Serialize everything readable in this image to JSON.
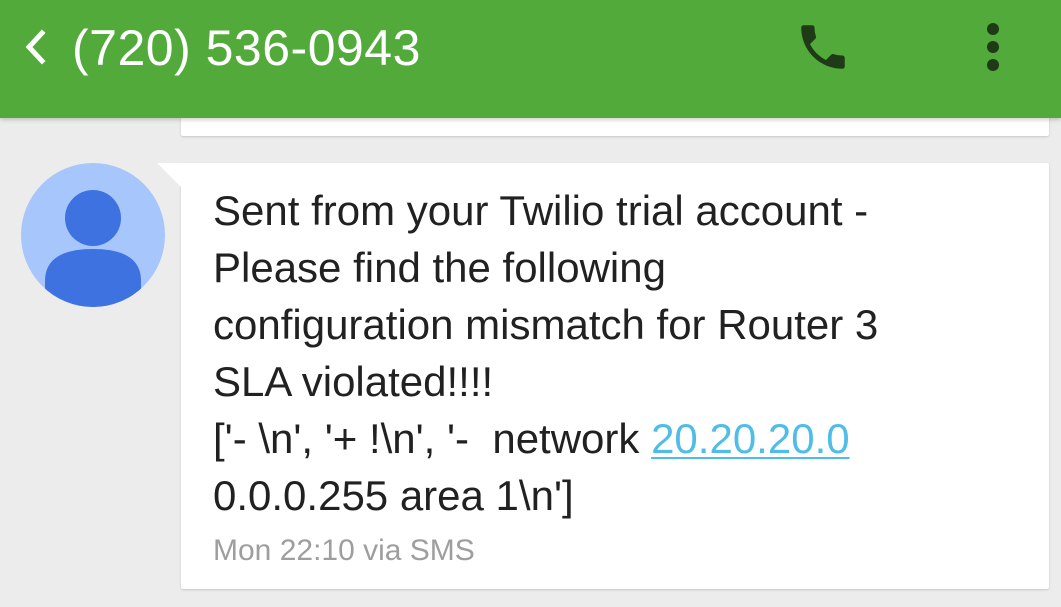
{
  "app_bar": {
    "title": "(720) 536-0943",
    "background_color": "#52aa3a",
    "icons": {
      "back": "chevron-left-icon",
      "call": "phone-icon",
      "more": "more-vert-icon"
    }
  },
  "conversation": {
    "contact_avatar": {
      "icon": "person-icon",
      "background_color": "#a7c6fb",
      "figure_color": "#3d72e0"
    },
    "message": {
      "lines": [
        "Sent from your Twilio trial account -",
        "Please find the following",
        "configuration mismatch for Router 3",
        "SLA violated!!!!"
      ],
      "code_line_prefix": "['- \\n', '+ !\\n', '-  network ",
      "link_text": "20.20.20.0",
      "code_line_end": "0.0.0.255 area 1\\n']",
      "link_color": "#4fbde8",
      "meta": "Mon 22:10 via SMS"
    }
  }
}
